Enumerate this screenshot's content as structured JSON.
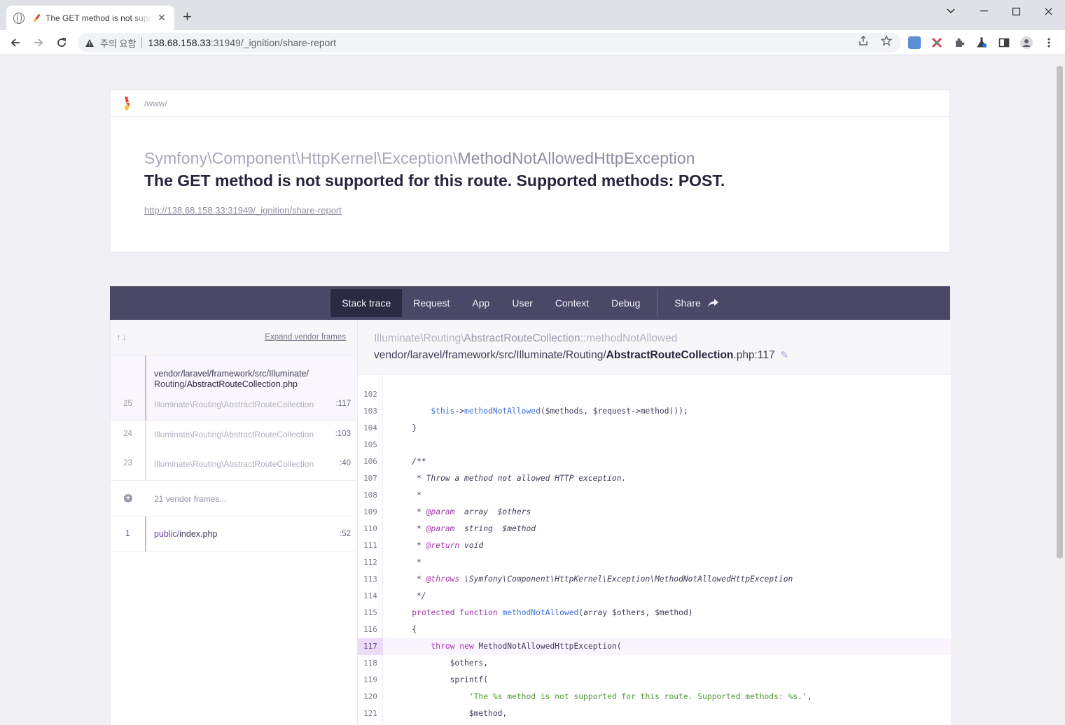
{
  "browser": {
    "tab_title": "The GET method is not supported for this route. Supported methods: POST.",
    "tab_close": "✕",
    "new_tab": "+",
    "security_label": "주의 요함",
    "url_host": "138.68.158.33",
    "url_path": ":31949/_ignition/share-report"
  },
  "page": {
    "app_path": "/www/",
    "exception_namespace": "Symfony\\Component\\HttpKernel\\Exception\\",
    "exception_class": "MethodNotAllowedHttpException",
    "exception_message": "The GET method is not supported for this route. Supported methods: POST.",
    "request_url": "http://138.68.158.33:31949/_ignition/share-report"
  },
  "menu": {
    "items": [
      "Stack trace",
      "Request",
      "App",
      "User",
      "Context",
      "Debug"
    ],
    "active": "Stack trace",
    "share_label": "Share"
  },
  "frames_panel": {
    "expand_label": "Expand vendor frames",
    "selected_file_dir": "vendor/laravel/framework/src/Illuminate/",
    "selected_file_subdir": "Routing/",
    "selected_file_name": "AbstractRouteCollection.php",
    "frames": [
      {
        "num": "25",
        "class_ns": "Illuminate\\Routing\\",
        "class_name": "AbstractRouteCollection",
        "line": ":117"
      },
      {
        "num": "24",
        "class_ns": "Illuminate\\Routing\\",
        "class_name": "AbstractRouteCollection",
        "line": ":103"
      },
      {
        "num": "23",
        "class_ns": "Illuminate\\Routing\\",
        "class_name": "AbstractRouteCollection",
        "line": ":40"
      }
    ],
    "vendor_frames_label": "21 vendor frames...",
    "app_frame": {
      "num": "1",
      "dir": "public/",
      "file": "index.php",
      "line": ":52"
    }
  },
  "code_view": {
    "class_ns": "Illuminate\\Routing\\",
    "class_name": "AbstractRouteCollection",
    "method": "::methodNotAllowed",
    "file_dir": "vendor/laravel/framework/src/Illuminate/Routing/",
    "file_name": "AbstractRouteCollection",
    "file_ext": ".php:117",
    "highlight_line": 117,
    "line_numbers": [
      "102",
      "103",
      "104",
      "105",
      "106",
      "107",
      "108",
      "109",
      "110",
      "111",
      "112",
      "113",
      "114",
      "115",
      "116",
      "117",
      "118",
      "119",
      "120",
      "121"
    ]
  }
}
